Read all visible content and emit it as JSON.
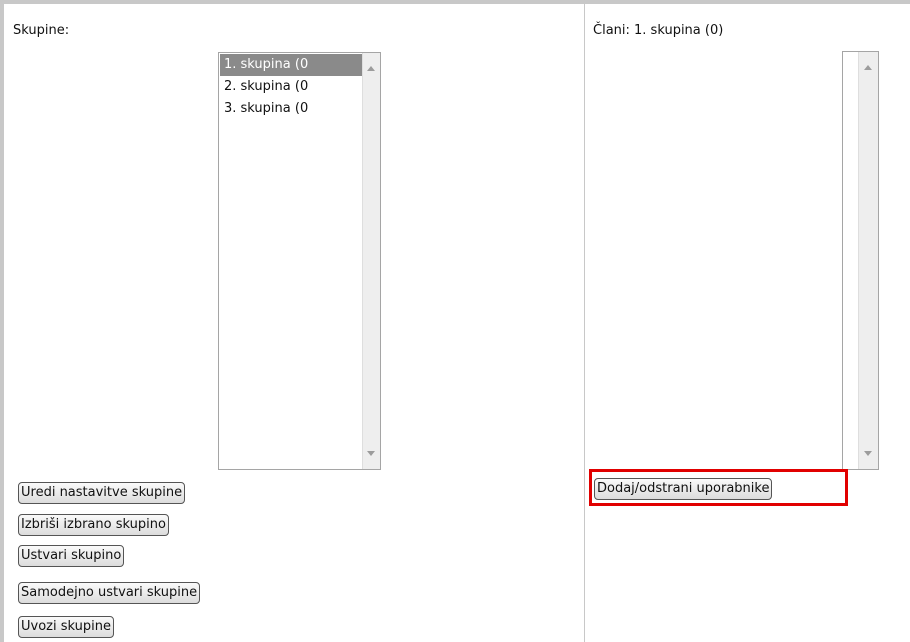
{
  "groups": {
    "label": "Skupine:",
    "items": [
      "1. skupina (0",
      "2. skupina (0",
      "3. skupina (0"
    ],
    "selected_index": 0
  },
  "members": {
    "label": "Člani: 1. skupina (0)"
  },
  "buttons": {
    "edit_settings": "Uredi nastavitve skupine",
    "delete_selected": "Izbriši izbrano skupino",
    "create": "Ustvari skupino",
    "auto_create": "Samodejno ustvari skupine",
    "import": "Uvozi skupine",
    "add_remove_users": "Dodaj/odstrani uporabnike"
  },
  "colors": {
    "highlight": "#e10000",
    "selected_item_bg": "#8a8a8a"
  }
}
